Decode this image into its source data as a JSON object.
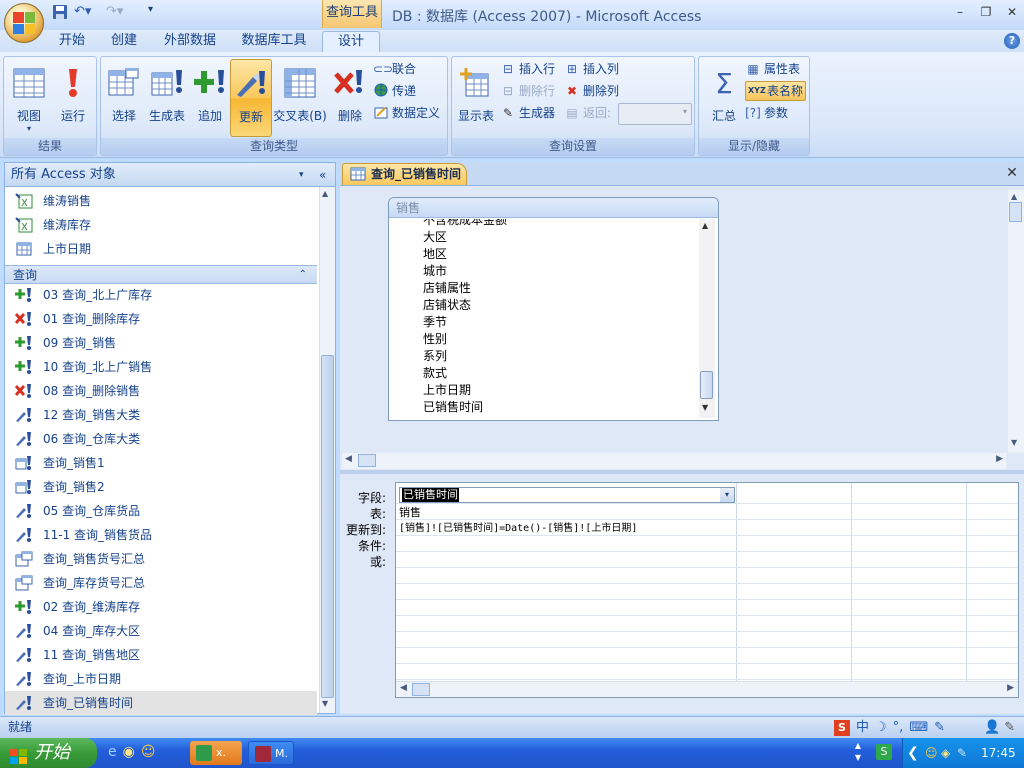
{
  "window": {
    "title": "DB : 数据库 (Access 2007) - Microsoft Access",
    "context_tab": "查询工具",
    "minimize": "–",
    "restore": "❐",
    "close": "✕"
  },
  "tabs": [
    "开始",
    "创建",
    "外部数据",
    "数据库工具",
    "设计"
  ],
  "active_tab": "设计",
  "ribbon": {
    "groups": {
      "results": "结果",
      "query_type": "查询类型",
      "query_setup": "查询设置",
      "show_hide": "显示/隐藏"
    },
    "results": {
      "view": "视图",
      "run": "运行"
    },
    "query_type": {
      "select": "选择",
      "make_table": "生成表",
      "append": "追加",
      "update": "更新",
      "crosstab": "交叉表(B)",
      "delete": "删除",
      "union": "联合",
      "pass_through": "传递",
      "data_definition": "数据定义"
    },
    "query_setup": {
      "show_table": "显示表",
      "insert_row": "插入行",
      "delete_row": "删除行",
      "builder": "生成器",
      "insert_col": "插入列",
      "delete_col": "删除列",
      "return": "返回:"
    },
    "show_hide": {
      "totals": "汇总",
      "property_sheet": "属性表",
      "table_names": "表名称",
      "parameters": "参数"
    }
  },
  "nav_pane": {
    "header": "所有 Access 对象",
    "top_items": [
      "维涛销售",
      "维涛库存",
      "上市日期"
    ],
    "group_label": "查询",
    "query_items": [
      {
        "label": "03 查询_北上广库存",
        "kind": "append"
      },
      {
        "label": "01 查询_删除库存",
        "kind": "delete"
      },
      {
        "label": "09 查询_销售",
        "kind": "append"
      },
      {
        "label": "10 查询_北上广销售",
        "kind": "append"
      },
      {
        "label": "08 查询_删除销售",
        "kind": "delete"
      },
      {
        "label": "12 查询_销售大类",
        "kind": "update"
      },
      {
        "label": "06 查询_仓库大类",
        "kind": "update"
      },
      {
        "label": "查询_销售1",
        "kind": "maketable"
      },
      {
        "label": "查询_销售2",
        "kind": "maketable"
      },
      {
        "label": "05 查询_仓库货品",
        "kind": "update"
      },
      {
        "label": "11-1 查询_销售货品",
        "kind": "update"
      },
      {
        "label": "查询_销售货号汇总",
        "kind": "select"
      },
      {
        "label": "查询_库存货号汇总",
        "kind": "select"
      },
      {
        "label": "02 查询_维涛库存",
        "kind": "append"
      },
      {
        "label": "04 查询_库存大区",
        "kind": "update"
      },
      {
        "label": "11 查询_销售地区",
        "kind": "update"
      },
      {
        "label": "查询_上市日期",
        "kind": "update"
      },
      {
        "label": "查询_已销售时间",
        "kind": "update",
        "selected": true
      }
    ]
  },
  "document": {
    "tab_label": "查询_已销售时间",
    "field_list": {
      "title": "销售",
      "partial_top": "不含税成本金额",
      "fields": [
        "大区",
        "地区",
        "城市",
        "店铺属性",
        "店铺状态",
        "季节",
        "性别",
        "系列",
        "款式",
        "上市日期",
        "已销售时间"
      ]
    },
    "grid": {
      "row_labels": [
        "字段:",
        "表:",
        "更新到:",
        "条件:",
        "或:"
      ],
      "field_value": "已销售时间",
      "table_value": "销售",
      "update_to": "[销售]![已销售时间]=Date()-[销售]![上市日期]"
    }
  },
  "status": "就绪",
  "taskbar": {
    "start": "开始",
    "btn1": "x.",
    "btn2": "M.",
    "clock": "17:45",
    "ime": "中"
  },
  "colors": {
    "accent_orange": "#f9c85c",
    "ribbon_blue": "#dbe8fa",
    "taskbar_blue": "#245edb"
  }
}
